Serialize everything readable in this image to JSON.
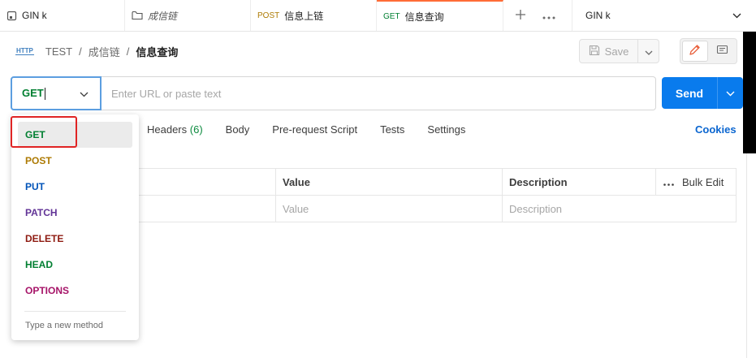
{
  "tabs": [
    {
      "label": "GIN k",
      "method": "",
      "icon": "request-doc-icon"
    },
    {
      "label": "成信链",
      "method": "",
      "icon": "folder-icon"
    },
    {
      "label": "信息上链",
      "method": "POST"
    },
    {
      "label": "信息查询",
      "method": "GET"
    }
  ],
  "tab_controls": {
    "new_tab_icon": "plus-icon",
    "more_icon": "ellipsis-icon"
  },
  "environment": {
    "label": "GIN k",
    "icon": "chevron-down-icon"
  },
  "breadcrumb": {
    "badge": "HTTP",
    "workspace": "TEST",
    "separator": "/",
    "folder": "成信链",
    "request": "信息查询"
  },
  "toolbar": {
    "save_label": "Save"
  },
  "request": {
    "method": "GET",
    "url_placeholder": "Enter URL or paste text",
    "send_label": "Send"
  },
  "request_tabs": [
    {
      "label": "Headers",
      "count": "(6)"
    },
    {
      "label": "Body",
      "count": ""
    },
    {
      "label": "Pre-request Script",
      "count": ""
    },
    {
      "label": "Tests",
      "count": ""
    },
    {
      "label": "Settings",
      "count": ""
    }
  ],
  "cookies_label": "Cookies",
  "params_table": {
    "headers": [
      "Value",
      "Description"
    ],
    "placeholders": [
      "Value",
      "Description"
    ],
    "bulk_edit": "Bulk Edit"
  },
  "method_menu": {
    "options": [
      {
        "label": "GET",
        "color": "#007f31"
      },
      {
        "label": "POST",
        "color": "#ad7a03"
      },
      {
        "label": "PUT",
        "color": "#0053b8"
      },
      {
        "label": "PATCH",
        "color": "#623497"
      },
      {
        "label": "DELETE",
        "color": "#8e1a10"
      },
      {
        "label": "HEAD",
        "color": "#007f31"
      },
      {
        "label": "OPTIONS",
        "color": "#a61468"
      }
    ],
    "selected": "GET",
    "custom_placeholder": "Type a new method"
  },
  "colors": {
    "accent": "#097bed",
    "active_tab": "#ff6c37",
    "highlight": "#e02424",
    "link": "#0b66d0"
  }
}
